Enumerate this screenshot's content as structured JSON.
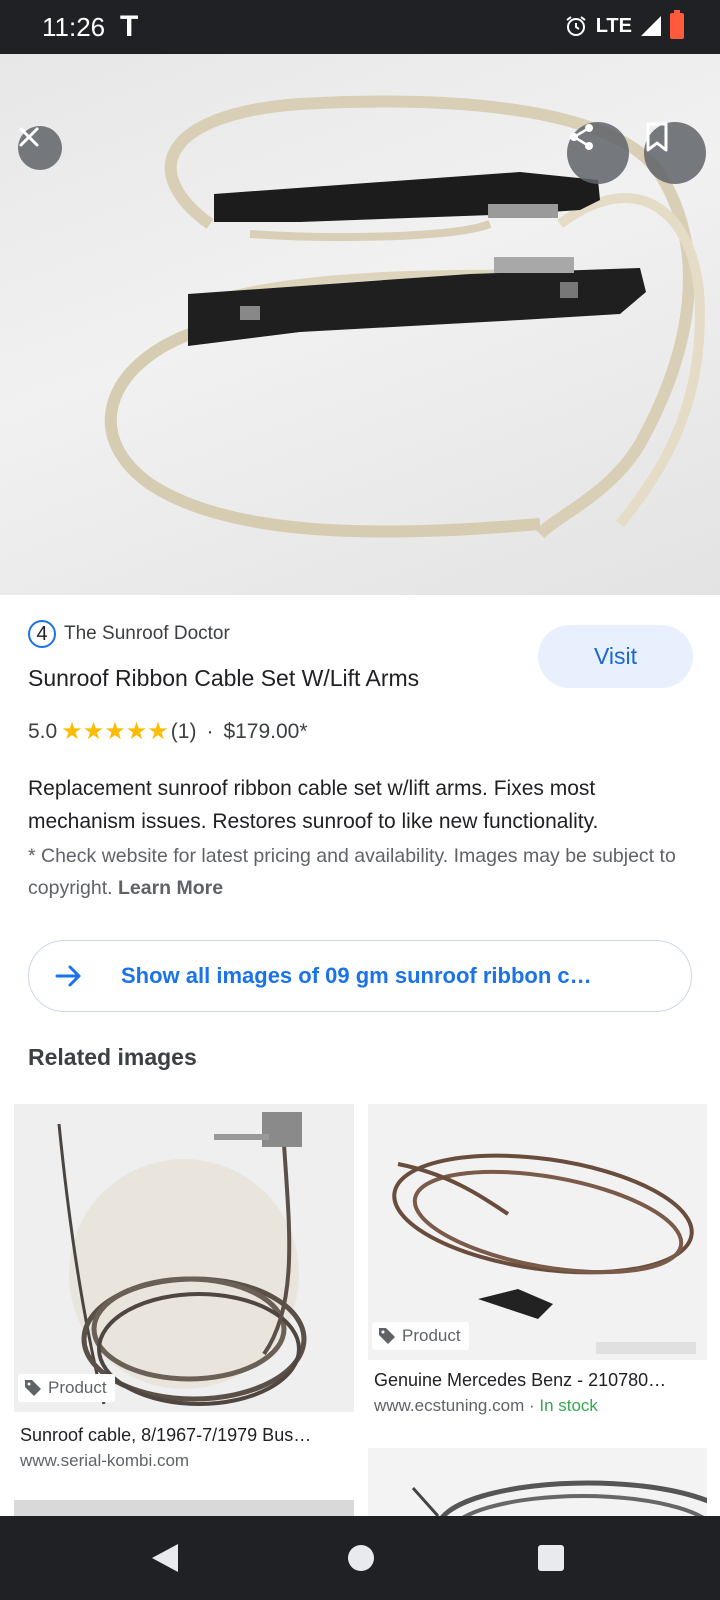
{
  "status_bar": {
    "time": "11:26",
    "carrier": "T",
    "network": "LTE"
  },
  "product": {
    "source_badge": "4",
    "source_name": "The Sunroof Doctor",
    "visit_label": "Visit",
    "title": "Sunroof Ribbon Cable Set W/Lift Arms",
    "rating": "5.0",
    "stars": 5,
    "rating_count": "(1)",
    "separator": "·",
    "price": "$179.00*",
    "description": "Replacement sunroof ribbon cable set w/lift arms. Fixes most mechanism issues. Restores sunroof to like new functionality.",
    "disclaimer": "* Check website for latest pricing and availability. Images may be subject to copyright.",
    "learn_more": "Learn More"
  },
  "show_all": {
    "label": "Show all images of 09 gm sunroof ribbon c…"
  },
  "related": {
    "title": "Related images",
    "items": [
      {
        "tag": "Product",
        "title": "Sunroof cable, 8/1967-7/1979 Bus…",
        "site": "www.serial-kombi.com",
        "stock": ""
      },
      {
        "tag": "Product",
        "title": "Genuine Mercedes Benz - 210780…",
        "site": "www.ecstuning.com",
        "stock_sep": " · ",
        "stock": "In stock"
      }
    ]
  },
  "colors": {
    "accent": "#1a73e8",
    "visit_bg": "#e8f0fe",
    "star": "#fbbc04",
    "in_stock": "#34a853",
    "bar": "#202124"
  },
  "icons": {
    "close": "close-icon",
    "share": "share-icon",
    "save": "bookmark-icon",
    "arrow": "arrow-right-icon",
    "tag": "tag-icon"
  }
}
